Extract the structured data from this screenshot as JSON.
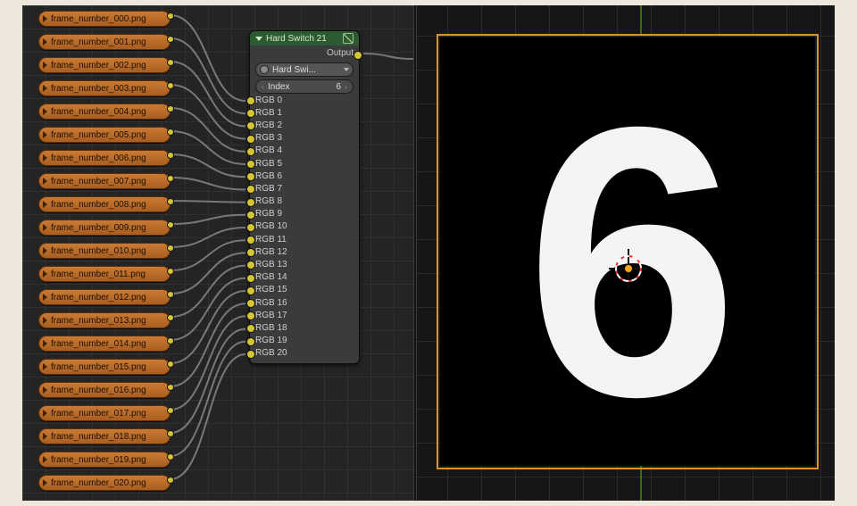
{
  "frame_nodes": [
    {
      "label": "frame_number_000.png"
    },
    {
      "label": "frame_number_001.png"
    },
    {
      "label": "frame_number_002.png"
    },
    {
      "label": "frame_number_003.png"
    },
    {
      "label": "frame_number_004.png"
    },
    {
      "label": "frame_number_005.png"
    },
    {
      "label": "frame_number_006.png"
    },
    {
      "label": "frame_number_007.png"
    },
    {
      "label": "frame_number_008.png"
    },
    {
      "label": "frame_number_009.png"
    },
    {
      "label": "frame_number_010.png"
    },
    {
      "label": "frame_number_011.png"
    },
    {
      "label": "frame_number_012.png"
    },
    {
      "label": "frame_number_013.png"
    },
    {
      "label": "frame_number_014.png"
    },
    {
      "label": "frame_number_015.png"
    },
    {
      "label": "frame_number_016.png"
    },
    {
      "label": "frame_number_017.png"
    },
    {
      "label": "frame_number_018.png"
    },
    {
      "label": "frame_number_019.png"
    },
    {
      "label": "frame_number_020.png"
    }
  ],
  "switch": {
    "title": "Hard Switch 21",
    "output_label": "Output",
    "dropdown_label": "Hard Swi...",
    "index_label": "Index",
    "index_value": "6",
    "inputs": [
      "RGB 0",
      "RGB 1",
      "RGB 2",
      "RGB 3",
      "RGB 4",
      "RGB 5",
      "RGB 6",
      "RGB 7",
      "RGB 8",
      "RGB 9",
      "RGB 10",
      "RGB 11",
      "RGB 12",
      "RGB 13",
      "RGB 14",
      "RGB 15",
      "RGB 16",
      "RGB 17",
      "RGB 18",
      "RGB 19",
      "RGB 20"
    ]
  },
  "viewport": {
    "number": "6"
  },
  "colors": {
    "frame_node": "#c97a33",
    "switch_header": "#2b5a33",
    "frame_border": "#e3901e",
    "socket": "#d4c634"
  }
}
